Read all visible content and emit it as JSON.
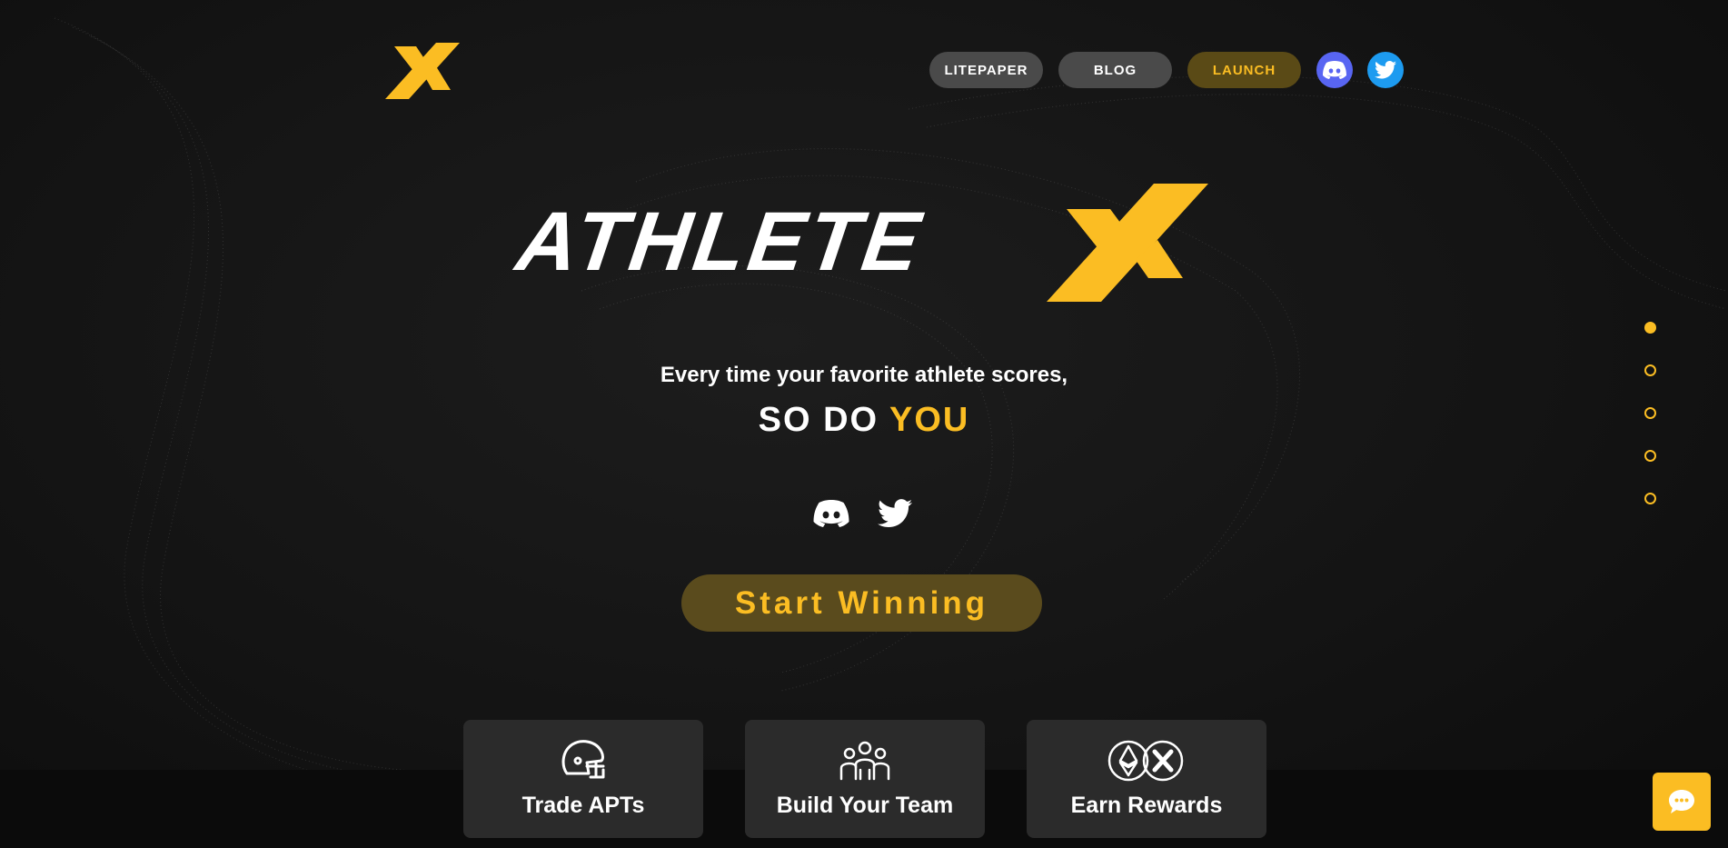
{
  "nav": {
    "litepaper": "LITEPAPER",
    "blog": "BLOG",
    "launch": "LAUNCH",
    "discord_icon": "discord-icon",
    "twitter_icon": "twitter-icon"
  },
  "hero": {
    "wordmark": "ATHLETE",
    "wordmark_x": "X",
    "tagline": "Every time your favorite athlete scores,",
    "slogan_main": "SO DO ",
    "slogan_accent": "YOU",
    "cta": "Start Winning"
  },
  "pager": {
    "count": 5,
    "active_index": 0
  },
  "features": [
    {
      "label": "Trade APTs",
      "icon": "football-helmet-icon"
    },
    {
      "label": "Build Your Team",
      "icon": "team-icon"
    },
    {
      "label": "Earn Rewards",
      "icon": "ethereum-athletex-token-icon"
    }
  ],
  "chat": {
    "icon": "chat-bubble-icon"
  },
  "colors": {
    "accent": "#fbbd23",
    "background": "#141414",
    "card": "#2b2b2b",
    "discord": "#5865f2",
    "twitter": "#1d9bf0"
  }
}
